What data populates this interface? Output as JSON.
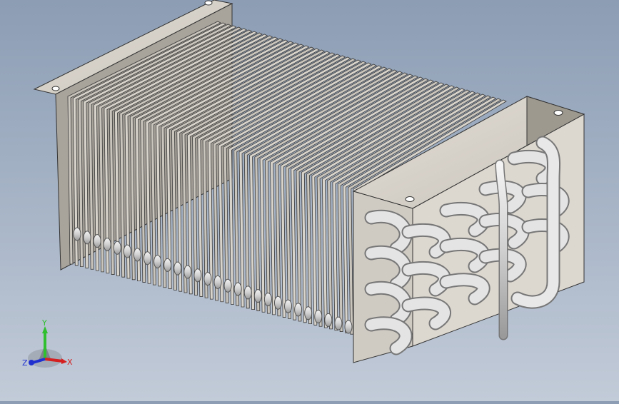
{
  "viewport": {
    "background_top": "#8c9db4",
    "background_bottom": "#c2cbd8",
    "model": {
      "fin_color": "#d9d4cc",
      "fin_edge_color": "#3a3a3a",
      "plate_color": "#d7d2ca",
      "tube_color": "#e2e2e2"
    }
  },
  "triad": {
    "y_label": "Y",
    "x_label": "X",
    "z_label": "Z",
    "y_color": "#2fbf2f",
    "x_color": "#d42020",
    "z_color": "#2030d0"
  }
}
